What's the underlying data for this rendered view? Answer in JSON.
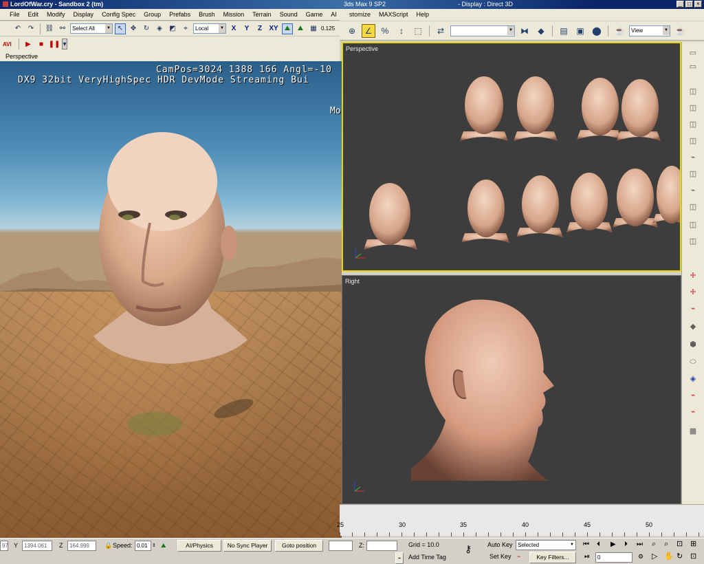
{
  "sandbox": {
    "title": "LordOfWar.cry - Sandbox 2 (tm)",
    "menu": [
      "File",
      "Edit",
      "Modify",
      "Display",
      "Config Spec",
      "Group",
      "Prefabs",
      "Brush",
      "Mission",
      "Terrain",
      "Sound",
      "Game",
      "AI"
    ],
    "toolbar": {
      "selection_combo": "Select All",
      "coord_combo": "Local",
      "axis_x": "X",
      "axis_y": "Y",
      "axis_z": "Z",
      "axis_xy": "XY",
      "grid_value": "0.125"
    },
    "toolbar2": {
      "avi_label": "AVI"
    },
    "viewport_label": "Perspective",
    "overlay_line1": "CamPos=3024 1388 166 Angl=-10",
    "overlay_line2": "DX9 32bit VeryHighSpec HDR DevMode Streaming Bui",
    "overlay_line3": "Mo"
  },
  "max": {
    "title_left": "3ds Max 9 SP2",
    "title_right": "- Display : Direct 3D",
    "menu": [
      "stomize",
      "MAXScript",
      "Help"
    ],
    "view_combo": "View",
    "viewport_top_label": "Perspective",
    "viewport_bottom_label": "Right",
    "timeline_ticks": [
      "25",
      "30",
      "35",
      "40",
      "45",
      "50"
    ]
  },
  "status": {
    "x_value": "97",
    "y_label": "Y",
    "y_value": "1394.061",
    "z_label": "Z",
    "z_value": "164.999",
    "speed_label": "Speed:",
    "speed_value": "0.01",
    "ai_physics_btn": "AI/Physics",
    "no_sync_btn": "No Sync Player",
    "goto_btn": "Goto position",
    "max_z_label": "Z:",
    "grid_label": "Grid = 10.0",
    "add_time_tag": "Add Time Tag",
    "auto_key": "Auto Key",
    "set_key": "Set Key",
    "key_mode_combo": "Selected",
    "key_filters": "Key Filters...",
    "frame_value": "0"
  }
}
